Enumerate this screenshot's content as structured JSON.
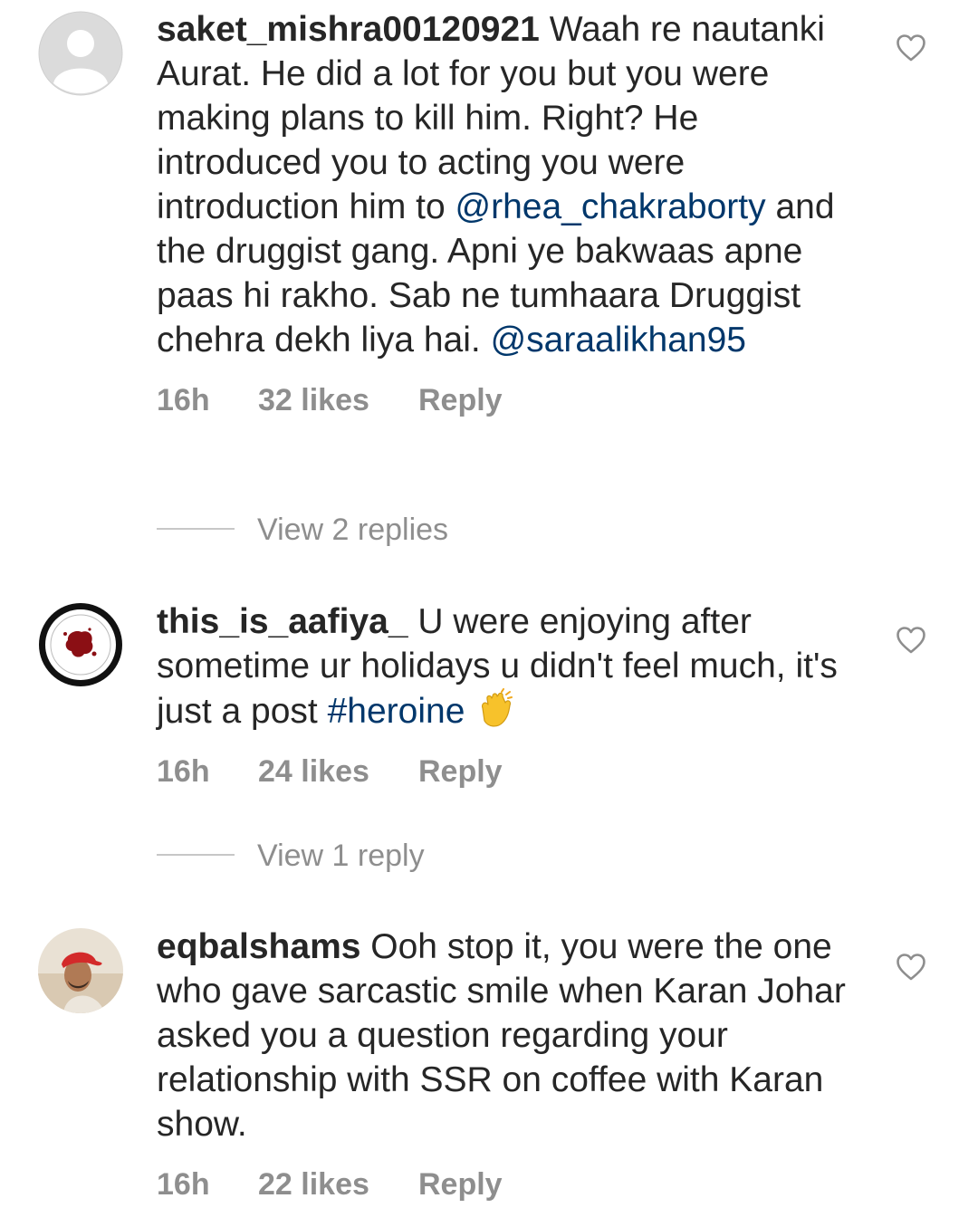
{
  "comments": [
    {
      "username": "saket_mishra00120921",
      "segments": [
        {
          "text": " Waah re nautanki Aurat. He did a lot for you but you were making plans to kill him. Right? He introduced you to acting you were introduction him to ",
          "type": "plain"
        },
        {
          "text": "@rhea_chakraborty",
          "type": "mention"
        },
        {
          "text": " and the druggist gang. Apni ye bakwaas apne paas hi rakho. Sab ne tumhaara Druggist chehra dekh liya hai. ",
          "type": "plain"
        },
        {
          "text": "@saraalikhan95",
          "type": "mention"
        }
      ],
      "time": "16h",
      "likes": "32 likes",
      "reply_label": "Reply",
      "view_replies": "View 2 replies",
      "avatar": "default-user-avatar"
    },
    {
      "username": "this_is_aafiya_",
      "segments": [
        {
          "text": " U were enjoying after sometime ur holidays u didn't feel much, it's just a post ",
          "type": "plain"
        },
        {
          "text": "#heroine",
          "type": "hashtag"
        }
      ],
      "emoji": "clapping-hands-emoji",
      "time": "16h",
      "likes": "24 likes",
      "reply_label": "Reply",
      "view_replies": "View 1 reply",
      "avatar": "red-stamp-avatar"
    },
    {
      "username": "eqbalshams",
      "segments": [
        {
          "text": " Ooh stop it, you were the one who gave sarcastic smile when Karan Johar asked you a question regarding your relationship with SSR on coffee with Karan show.",
          "type": "plain"
        }
      ],
      "time": "16h",
      "likes": "22 likes",
      "reply_label": "Reply",
      "avatar": "photo-avatar-red-cap"
    }
  ],
  "colors": {
    "text": "#262626",
    "link": "#00376b",
    "secondary": "#8e8e8e",
    "divider": "#c7c7c7"
  },
  "icons": {
    "like": "heart-outline-icon"
  }
}
